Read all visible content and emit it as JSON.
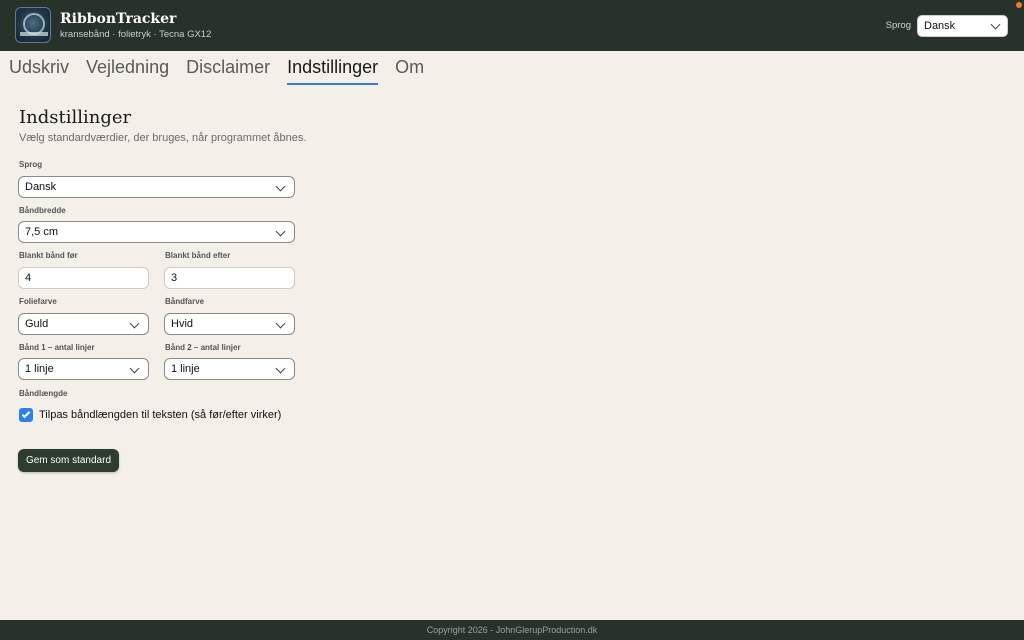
{
  "header": {
    "app_title": "RibbonTracker",
    "subtitle": "kransebånd · folietryk · Tecna GX12",
    "language_label": "Sprog",
    "language_value": "Dansk",
    "background_color": "#27332a"
  },
  "tabs": [
    {
      "label": "Udskriv",
      "active": false
    },
    {
      "label": "Vejledning",
      "active": false
    },
    {
      "label": "Disclaimer",
      "active": false
    },
    {
      "label": "Indstillinger",
      "active": true
    },
    {
      "label": "Om",
      "active": false
    }
  ],
  "settings": {
    "title": "Indstillinger",
    "description": "Vælg standardværdier, der bruges, når programmet åbnes.",
    "language": {
      "label": "Sprog",
      "value": "Dansk"
    },
    "ribbon_width": {
      "label": "Båndbredde",
      "value": "7,5 cm"
    },
    "blank_before": {
      "label": "Blankt bånd før",
      "value": "4"
    },
    "blank_after": {
      "label": "Blankt bånd efter",
      "value": "3"
    },
    "foil_color": {
      "label": "Foliefarve",
      "value": "Guld"
    },
    "ribbon_color": {
      "label": "Båndfarve",
      "value": "Hvid"
    },
    "ribbon1_lines": {
      "label": "Bånd 1 – antal linjer",
      "value": "1 linje"
    },
    "ribbon2_lines": {
      "label": "Bånd 2 – antal linjer",
      "value": "1 linje"
    },
    "ribbon_length": {
      "label": "Båndlængde",
      "checkbox_label": "Tilpas båndlængden til teksten (så før/efter virker)",
      "checked": true
    },
    "save_label": "Gem som standard"
  },
  "footer": {
    "text": "Copyright 2026 - JohnGlerupProduction.dk"
  },
  "colors": {
    "accent": "#2f7ef0",
    "button": "#2c3c2f",
    "background": "#f4f0e9"
  }
}
